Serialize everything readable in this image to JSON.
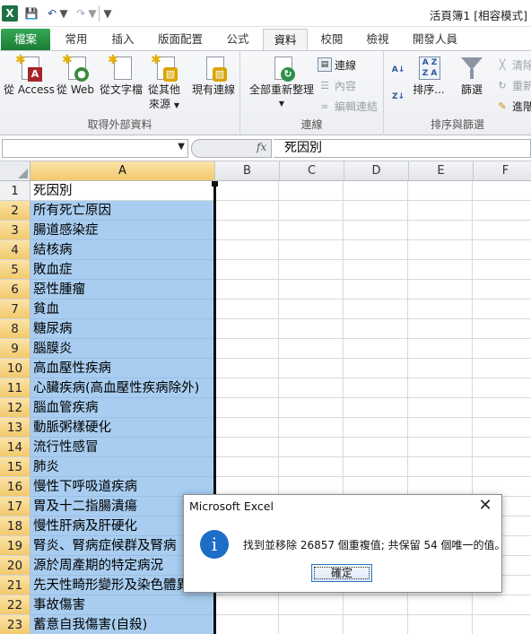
{
  "title_bar": {
    "window_title": "活頁簿1  [相容模式]",
    "icons": {
      "app": "excel-icon",
      "save": "save-icon",
      "undo": "undo-icon",
      "redo": "redo-icon",
      "customize": "customize-quick-access-icon"
    }
  },
  "ribbon_tabs": [
    "檔案",
    "常用",
    "插入",
    "版面配置",
    "公式",
    "資料",
    "校閱",
    "檢視",
    "開發人員"
  ],
  "active_tab": "資料",
  "ribbon": {
    "external_data": {
      "caption": "取得外部資料",
      "buttons": [
        "從 Access",
        "從 Web",
        "從文字檔",
        "從其他",
        "來源",
        "現有連線"
      ]
    },
    "connections": {
      "caption": "連線",
      "refresh_all": "全部重新整理",
      "links": [
        "連線",
        "內容",
        "編輯連結"
      ]
    },
    "sort_filter": {
      "caption": "排序與篩選",
      "sort": "排序...",
      "filter": "篩選",
      "clear": "清除",
      "reapply": "重新",
      "advanced": "進階"
    }
  },
  "formula_bar": {
    "name_box": "",
    "fx": "fx",
    "content": "死因別"
  },
  "columns": [
    "A",
    "B",
    "C",
    "D",
    "E",
    "F"
  ],
  "rows": [
    {
      "num": "1",
      "a": "死因別"
    },
    {
      "num": "2",
      "a": "所有死亡原因"
    },
    {
      "num": "3",
      "a": "腸道感染症"
    },
    {
      "num": "4",
      "a": "結核病"
    },
    {
      "num": "5",
      "a": "敗血症"
    },
    {
      "num": "6",
      "a": "惡性腫瘤"
    },
    {
      "num": "7",
      "a": "貧血"
    },
    {
      "num": "8",
      "a": "糖尿病"
    },
    {
      "num": "9",
      "a": "腦膜炎"
    },
    {
      "num": "10",
      "a": "高血壓性疾病"
    },
    {
      "num": "11",
      "a": "心臟疾病(高血壓性疾病除外)"
    },
    {
      "num": "12",
      "a": "腦血管疾病"
    },
    {
      "num": "13",
      "a": "動脈粥樣硬化"
    },
    {
      "num": "14",
      "a": "流行性感冒"
    },
    {
      "num": "15",
      "a": "肺炎"
    },
    {
      "num": "16",
      "a": "慢性下呼吸道疾病"
    },
    {
      "num": "17",
      "a": "胃及十二指腸潰瘍"
    },
    {
      "num": "18",
      "a": "慢性肝病及肝硬化"
    },
    {
      "num": "19",
      "a": "腎炎、腎病症候群及腎病"
    },
    {
      "num": "20",
      "a": "源於周產期的特定病況"
    },
    {
      "num": "21",
      "a": "先天性畸形變形及染色體異常"
    },
    {
      "num": "22",
      "a": "事故傷害"
    },
    {
      "num": "23",
      "a": "蓄意自我傷害(自殺)"
    }
  ],
  "dialog": {
    "title": "Microsoft Excel",
    "message": "找到並移除 26857 個重複值; 共保留 54 個唯一的值。",
    "ok": "確定",
    "close": "✕"
  },
  "colors": {
    "selection": "#a8cdf0",
    "file_tab": "#1f8a3b",
    "info": "#1d6ec7"
  }
}
